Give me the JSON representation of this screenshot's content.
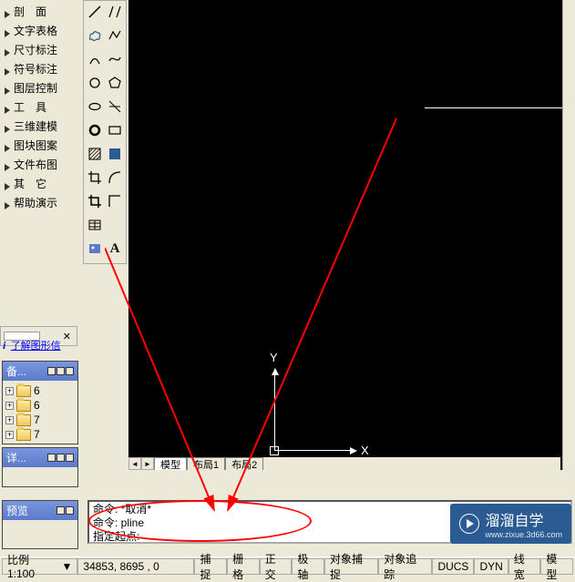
{
  "tree": {
    "items": [
      "剖　面",
      "文字表格",
      "尺寸标注",
      "符号标注",
      "图层控制",
      "工　具",
      "三维建模",
      "图块图案",
      "文件布图",
      "其　它",
      "帮助演示"
    ]
  },
  "info_link": "了解图形信",
  "panels": {
    "backup": {
      "title": "备...",
      "items": [
        "6",
        "6",
        "7",
        "7"
      ]
    },
    "detail": {
      "title": "详..."
    },
    "preview": {
      "title": "预览"
    }
  },
  "canvas": {
    "tabs": [
      "模型",
      "布局1",
      "布局2"
    ],
    "ucs": {
      "x": "X",
      "y": "Y"
    }
  },
  "command": {
    "lines": [
      "命令: *取消*",
      "命令: pline",
      "指定起点:"
    ]
  },
  "status": {
    "scale_label": "比例 1:100",
    "coords": "34853, 8695 , 0",
    "buttons": [
      "捕捉",
      "栅格",
      "正交",
      "极轴",
      "对象捕捉",
      "对象追踪",
      "DUCS",
      "DYN",
      "线宽",
      "模型"
    ]
  },
  "watermark": {
    "text": "溜溜自学",
    "sub": "www.zixue.3d66.com"
  }
}
